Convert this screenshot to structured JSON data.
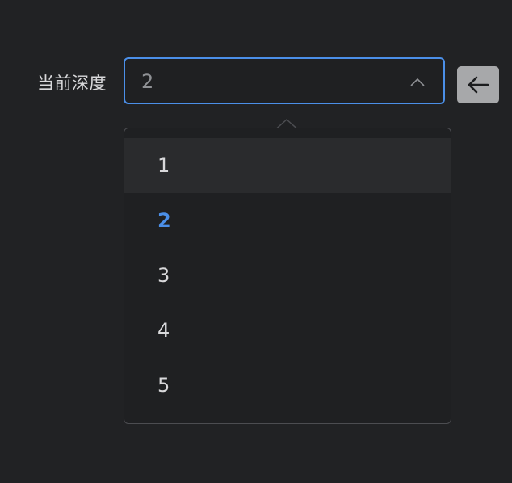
{
  "form": {
    "label": "当前深度",
    "current_value": "2"
  },
  "icons": {
    "chevron": "chevron-up-icon",
    "back": "arrow-left-icon"
  },
  "dropdown": {
    "options": [
      "1",
      "2",
      "3",
      "4",
      "5"
    ],
    "selected": "2",
    "hovered": "1"
  },
  "colors": {
    "accent": "#4b8fe8",
    "background": "#212224",
    "button": "#a7a8aa"
  }
}
